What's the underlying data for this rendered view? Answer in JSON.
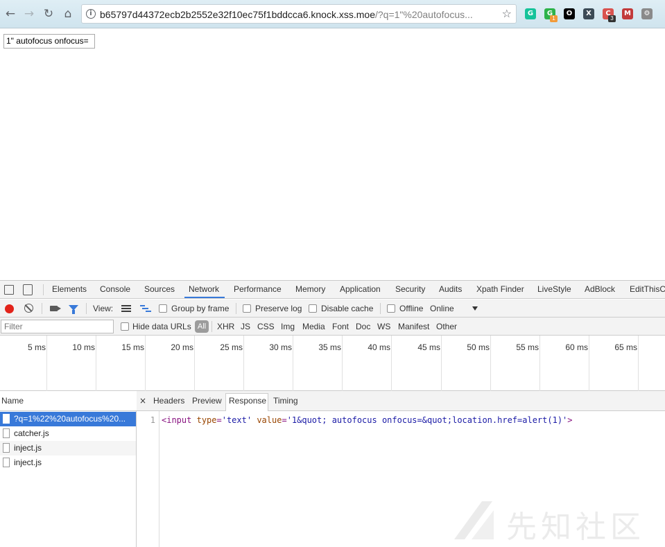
{
  "browser": {
    "url_host": "b65797d44372ecb2b2552e32f10ec75f1bddcca6.knock.xss.moe",
    "url_path": "/?q=1\"%20autofocus...",
    "extensions": [
      {
        "name": "grammarly-icon",
        "color": "#15c39a",
        "glyph": "G"
      },
      {
        "name": "extension-g-icon",
        "color": "#2db34a",
        "glyph": "G",
        "badge": "1",
        "badge_color": "#f29a38"
      },
      {
        "name": "circle-icon",
        "color": "#000000",
        "glyph": "O"
      },
      {
        "name": "x-extension-icon",
        "color": "#3b4a55",
        "glyph": "X"
      },
      {
        "name": "cookie-extension-icon",
        "color": "#d9534f",
        "glyph": "C",
        "badge": "3",
        "badge_color": "#333333"
      },
      {
        "name": "mask-extension-icon",
        "color": "#c23a3a",
        "glyph": "M"
      },
      {
        "name": "settings-gear-icon",
        "color": "#8a8a8a",
        "glyph": "⚙"
      }
    ]
  },
  "page": {
    "input_value": "1\" autofocus onfocus="
  },
  "devtools": {
    "tabs": [
      "Elements",
      "Console",
      "Sources",
      "Network",
      "Performance",
      "Memory",
      "Application",
      "Security",
      "Audits",
      "Xpath Finder",
      "LiveStyle",
      "AdBlock",
      "EditThisC"
    ],
    "active_tab": "Network",
    "toolbar": {
      "view_label": "View:",
      "group_by_frame": "Group by frame",
      "preserve_log": "Preserve log",
      "disable_cache": "Disable cache",
      "offline": "Offline",
      "throttling": "Online"
    },
    "filter": {
      "placeholder": "Filter",
      "hide_data_urls": "Hide data URLs",
      "types": [
        "All",
        "XHR",
        "JS",
        "CSS",
        "Img",
        "Media",
        "Font",
        "Doc",
        "WS",
        "Manifest",
        "Other"
      ]
    },
    "timeline_ticks": [
      "5 ms",
      "10 ms",
      "15 ms",
      "20 ms",
      "25 ms",
      "30 ms",
      "35 ms",
      "40 ms",
      "45 ms",
      "50 ms",
      "55 ms",
      "60 ms",
      "65 ms"
    ],
    "requests": {
      "header": "Name",
      "items": [
        "?q=1%22%20autofocus%20...",
        "catcher.js",
        "inject.js",
        "inject.js"
      ]
    },
    "detail": {
      "close": "×",
      "tabs": [
        "Headers",
        "Preview",
        "Response",
        "Timing"
      ],
      "active_tab": "Response",
      "line_number": "1",
      "code": {
        "tag_open": "<input",
        "attr_type": "type",
        "eq1": "=",
        "val_type": "'text'",
        "attr_value": "value",
        "eq2": "=",
        "val_value": "'1&quot; autofocus onfocus=&quot;location.href=alert(1)'",
        "tag_close": ">"
      }
    }
  },
  "annotation": {
    "arrow_color": "#e8261e"
  },
  "watermark": {
    "text": "先知社区"
  }
}
